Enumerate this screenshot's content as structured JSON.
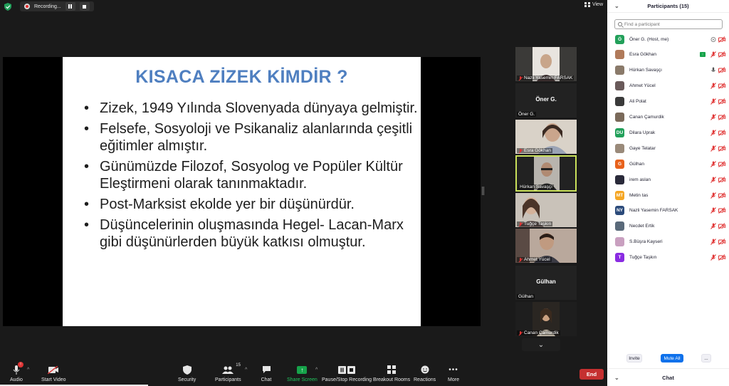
{
  "topbar": {
    "recording_label": "Recording...",
    "view_label": "View"
  },
  "slide": {
    "title": "KISACA ZİZEK KİMDİR ?",
    "bullets": [
      "Zizek, 1949 Yılında Slovenyada dünyaya gelmiştir.",
      "Felsefe, Sosyoloji ve Psikanaliz alanlarında çeşitli eğitimler almıştır.",
      "Günümüzde Filozof, Sosyolog ve Popüler Kültür Eleştirmeni olarak tanınmaktadır.",
      "Post-Marksist ekolde yer bir düşünürdür.",
      "Düşüncelerinin oluşmasında Hegel- Lacan-Marx gibi düşünürlerden büyük katkısı olmuştur."
    ],
    "title_color": "#4f7fc0"
  },
  "thumbnails": [
    {
      "name": "Nazli Yasemin FARSAK",
      "video": true
    },
    {
      "name": "Öner G.",
      "center_name": "Öner G.",
      "video": false
    },
    {
      "name": "Esra Gökhan",
      "video": true
    },
    {
      "name": "Hürkan Savaşçı",
      "video": true,
      "active": true
    },
    {
      "name": "Tuğçe Taşkın",
      "video": true
    },
    {
      "name": "Ahmet Yücel",
      "video": true
    },
    {
      "name": "Gülhan",
      "center_name": "Gülhan",
      "video": false
    },
    {
      "name": "Canan Çamurdik",
      "video": true
    }
  ],
  "toolbar": {
    "audio": "Audio",
    "audio_badge": "!",
    "start_video": "Start Video",
    "security": "Security",
    "participants": "Participants",
    "participants_count": "15",
    "chat": "Chat",
    "share_screen": "Share Screen",
    "pause_stop": "Pause/Stop Recording",
    "breakout": "Breakout Rooms",
    "reactions": "Reactions",
    "more": "More",
    "end": "End"
  },
  "panel": {
    "title": "Participants (15)",
    "search_placeholder": "Find a participant",
    "participants": [
      {
        "name": "Öner G. (Host, me)",
        "initials": "Ö",
        "color": "#22a05a",
        "mic": "host",
        "cam": "off"
      },
      {
        "name": "Esra Gökhan",
        "initials": "",
        "color": "#b07a5a",
        "mic": "muted",
        "cam": "off",
        "sharing": true
      },
      {
        "name": "Hürkan Savaşçı",
        "initials": "",
        "color": "#8a7a6a",
        "mic": "on",
        "cam": "off"
      },
      {
        "name": "Ahmet Yücel",
        "initials": "",
        "color": "#6a5a5a",
        "mic": "muted",
        "cam": "off"
      },
      {
        "name": "Ali Polat",
        "initials": "",
        "color": "#3a3a3a",
        "mic": "muted",
        "cam": "off"
      },
      {
        "name": "Canan Çamurdik",
        "initials": "",
        "color": "#7a6a5a",
        "mic": "muted",
        "cam": "off"
      },
      {
        "name": "Dilara Uprak",
        "initials": "DU",
        "color": "#22a05a",
        "mic": "muted",
        "cam": "off"
      },
      {
        "name": "Gaye Telatar",
        "initials": "",
        "color": "#9a8a7a",
        "mic": "muted",
        "cam": "off"
      },
      {
        "name": "Gülhan",
        "initials": "G",
        "color": "#e8621c",
        "mic": "muted",
        "cam": "off"
      },
      {
        "name": "irem aslan",
        "initials": "",
        "color": "#2a2a3a",
        "mic": "muted",
        "cam": "off"
      },
      {
        "name": "Metin tas",
        "initials": "MT",
        "color": "#f5a623",
        "mic": "muted",
        "cam": "off"
      },
      {
        "name": "Nazli Yasemin FARSAK",
        "initials": "NY",
        "color": "#2b4a7a",
        "mic": "muted",
        "cam": "off"
      },
      {
        "name": "Necdet Ertik",
        "initials": "",
        "color": "#5a6a7a",
        "mic": "muted",
        "cam": "off"
      },
      {
        "name": "S.Büşra Kayseri",
        "initials": "",
        "color": "#c9a0c0",
        "mic": "muted",
        "cam": "off"
      },
      {
        "name": "Tuğçe Taşkın",
        "initials": "T",
        "color": "#8a2be2",
        "mic": "muted",
        "cam": "off"
      }
    ],
    "invite": "Invite",
    "mute_all": "Mute All",
    "more": "...",
    "chat_title": "Chat"
  }
}
